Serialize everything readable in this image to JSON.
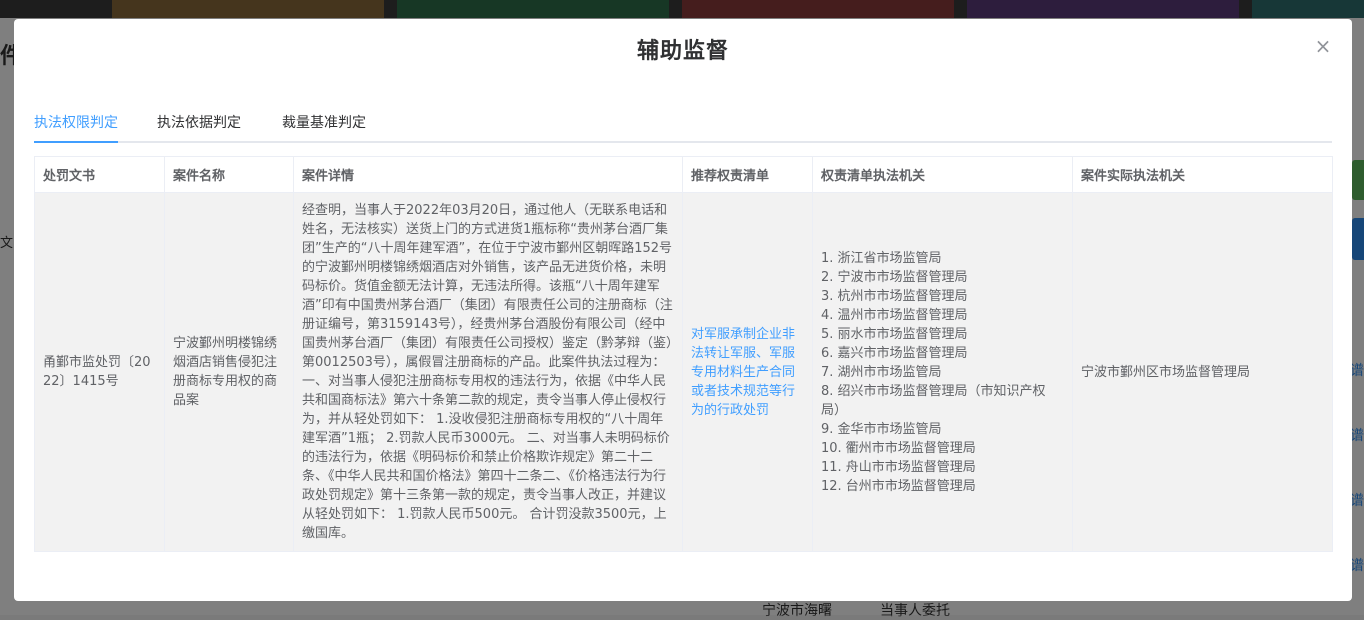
{
  "dialog": {
    "title": "辅助监督",
    "close_glyph": "×"
  },
  "tabs": [
    {
      "label": "执法权限判定",
      "active": true
    },
    {
      "label": "执法依据判定",
      "active": false
    },
    {
      "label": "裁量基准判定",
      "active": false
    }
  ],
  "table": {
    "headers": [
      "处罚文书",
      "案件名称",
      "案件详情",
      "推荐权责清单",
      "权责清单执法机关",
      "案件实际执法机关"
    ],
    "row": {
      "doc": "甬鄞市监处罚〔2022〕1415号",
      "case_name": "宁波鄞州明楼锦绣烟酒店销售侵犯注册商标专用权的商品案",
      "detail": "经查明，当事人于2022年03月20日，通过他人（无联系电话和姓名，无法核实）送货上门的方式进货1瓶标称“贵州茅台酒厂集团”生产的“八十周年建军酒”，在位于宁波市鄞州区朝晖路152号的宁波鄞州明楼锦绣烟酒店对外销售，该产品无进货价格，未明码标价。货值金额无法计算，无违法所得。该瓶“八十周年建军酒”印有中国贵州茅台酒厂（集团）有限责任公司的注册商标（注册证编号，第3159143号），经贵州茅台酒股份有限公司（经中国贵州茅台酒厂（集团）有限责任公司授权）鉴定（黔茅辩（鉴）第0012503号），属假冒注册商标的产品。此案件执法过程为：一、对当事人侵犯注册商标专用权的违法行为，依据《中华人民共和国商标法》第六十条第二款的规定，责令当事人停止侵权行为，并从轻处罚如下： 1.没收侵犯注册商标专用权的“八十周年建军酒”1瓶； 2.罚款人民币3000元。 二、对当事人未明码标价的违法行为，依据《明码标价和禁止价格欺诈规定》第二十二条、《中华人民共和国价格法》第四十二条二、《价格违法行为行政处罚规定》第十三条第一款的规定，责令当事人改正，并建议从轻处罚如下： 1.罚款人民币500元。 合计罚没款3500元，上缴国库。",
      "recommended": "对军服承制企业非法转让军服、军服专用材料生产合同或者技术规范等行为的行政处罚",
      "orgs": [
        "1. 浙江省市场监管局",
        "2. 宁波市市场监督管理局",
        "3. 杭州市市场监督管理局",
        "4. 温州市市场监督管理局",
        "5. 丽水市市场监督管理局",
        "6. 嘉兴市市场监督管理局",
        "7. 湖州市市场监管局",
        "8. 绍兴市市场监督管理局（市知识产权局）",
        "9. 金华市市场监管局",
        "10. 衢州市市场监督管理局",
        "11. 舟山市市场监督管理局",
        "12. 台州市市场监督管理局"
      ],
      "actual": "宁波市鄞州区市场监督管理局"
    }
  },
  "background": {
    "left_text_1": "件",
    "left_text_2": "文",
    "right_links": [
      "谱",
      "谱",
      "谱",
      "谱"
    ],
    "bottom_text_1": "宁波市海曙",
    "bottom_text_2": "当事人委托"
  },
  "colors": {
    "accent": "#409eff",
    "cell_bg": "#f2f2f2"
  }
}
